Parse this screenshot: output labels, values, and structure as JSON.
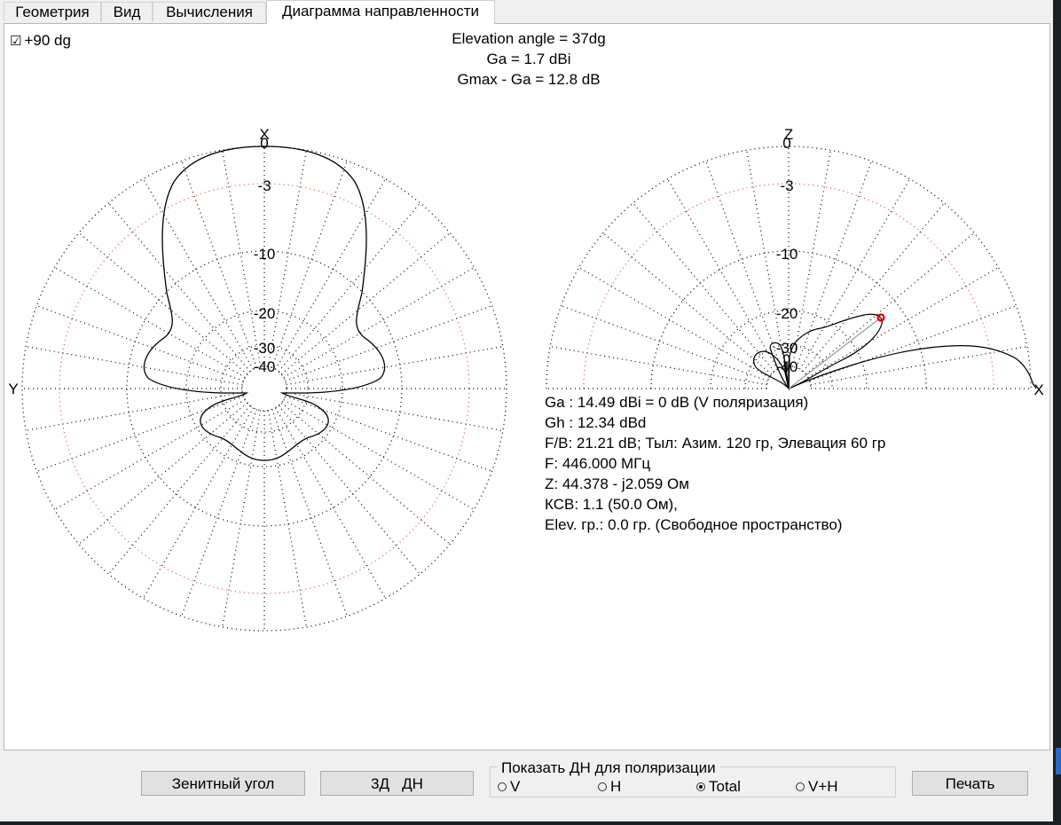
{
  "tabs": [
    {
      "label": "Геометрия",
      "active": false
    },
    {
      "label": "Вид",
      "active": false
    },
    {
      "label": "Вычисления",
      "active": false
    },
    {
      "label": "Диаграмма направленности",
      "active": true
    }
  ],
  "checkbox": {
    "mark": "☑",
    "label": "+90 dg",
    "checked": true
  },
  "header": {
    "elevation": "Elevation angle =  37dg",
    "ga": "Ga = 1.7 dBi",
    "gmax": "Gmax - Ga = 12.8 dB"
  },
  "azimuth_plot": {
    "top_label": "X",
    "left_label": "Y",
    "ring_labels": [
      "0",
      "-3",
      "-10",
      "-20",
      "-30",
      "-40"
    ]
  },
  "elevation_plot": {
    "top_label": "Z",
    "right_label": "X",
    "ring_labels": [
      "0",
      "-3",
      "-10",
      "-20",
      "-30",
      "-40"
    ],
    "marker_color": "#d00000"
  },
  "info": [
    "Ga : 14.49 dBi = 0 dB  (V поляризация)",
    "Gh : 12.34 dBd",
    "F/B: 21.21 dB; Тыл: Азим. 120 гр, Элевация 60 гр",
    "F: 446.000 МГц",
    "Z: 44.378 - j2.059 Ом",
    "КСВ: 1.1 (50.0 Ом),",
    "Elev. гр.: 0.0 гр. (Свободное пространство)"
  ],
  "buttons": {
    "zenith": "Зенитный угол",
    "pattern3d": "3Д   ДН",
    "print": "Печать"
  },
  "polarization": {
    "legend": "Показать ДН для поляризации",
    "options": [
      {
        "label": "V",
        "selected": false
      },
      {
        "label": "H",
        "selected": false
      },
      {
        "label": "Total",
        "selected": true
      },
      {
        "label": "V+H",
        "selected": false
      }
    ]
  },
  "colors": {
    "grid_dots": "#000000",
    "ring_red": "#e05050",
    "pattern": "#000000"
  }
}
